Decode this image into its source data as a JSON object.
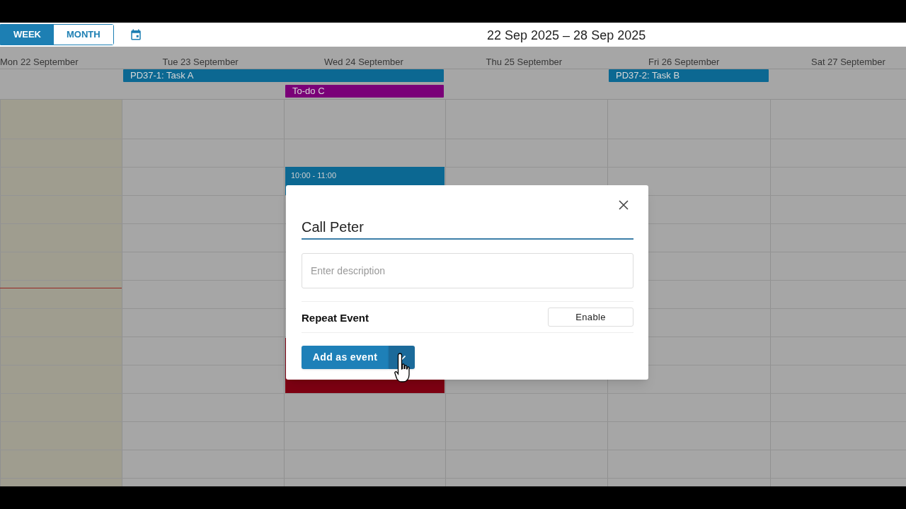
{
  "views": [
    {
      "label": "WEEK",
      "selected": true
    },
    {
      "label": "MONTH",
      "selected": false
    }
  ],
  "range_title": "22 Sep 2025 – 28 Sep 2025",
  "days": [
    {
      "label": "Mon 22 September",
      "today": true
    },
    {
      "label": "Tue 23 September",
      "today": false
    },
    {
      "label": "Wed 24 September",
      "today": false
    },
    {
      "label": "Thu 25 September",
      "today": false
    },
    {
      "label": "Fri 26 September",
      "today": false
    },
    {
      "label": "Sat 27 September",
      "today": false
    }
  ],
  "all_day_events": [
    {
      "title": "PD37-1: Task A",
      "color": "#0c6892"
    },
    {
      "title": "To-do C",
      "color": "#7a0078"
    },
    {
      "title": "PD37-2: Task B",
      "color": "#0c6892"
    }
  ],
  "timed_events": [
    {
      "time": "10:00 - 11:00",
      "color": "#0c6892"
    },
    {
      "color": "#7e0012"
    }
  ],
  "dialog": {
    "title_value": "Call Peter",
    "description_placeholder": "Enter description",
    "repeat_label": "Repeat Event",
    "repeat_button": "Enable",
    "primary_button": "Add as event"
  }
}
